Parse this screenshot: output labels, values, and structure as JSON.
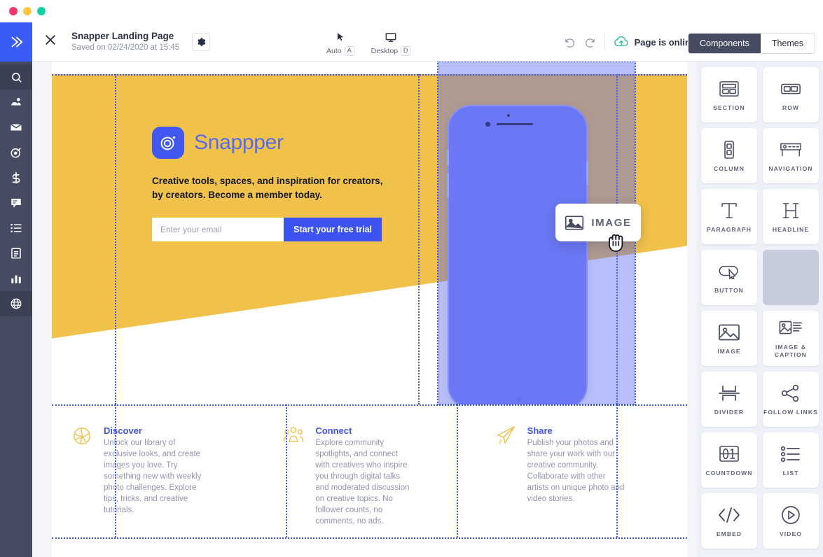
{
  "window": {
    "traffic_lights": [
      "close-red",
      "minimize-yellow",
      "maximize-green"
    ]
  },
  "rail": {
    "logo_icon": "chevrons-right-icon",
    "items": [
      {
        "name": "search",
        "icon": "search-icon",
        "active": true
      },
      {
        "name": "audience",
        "icon": "people-icon",
        "active": false
      },
      {
        "name": "campaigns",
        "icon": "envelope-icon",
        "active": false
      },
      {
        "name": "automations",
        "icon": "target-icon",
        "active": false
      },
      {
        "name": "ecommerce",
        "icon": "dollar-icon",
        "active": false
      },
      {
        "name": "conversations",
        "icon": "chat-icon",
        "active": false
      },
      {
        "name": "lists",
        "icon": "list-icon",
        "active": false
      },
      {
        "name": "content",
        "icon": "document-icon",
        "active": false
      },
      {
        "name": "reports",
        "icon": "bar-chart-icon",
        "active": false
      },
      {
        "name": "website",
        "icon": "globe-icon",
        "active": true
      }
    ]
  },
  "toolbar": {
    "close_icon": "close-icon",
    "title": "Snapper Landing Page",
    "saved": "Saved on 02/24/2020 at 15:45",
    "settings_icon": "gear-icon",
    "view_modes": [
      {
        "label": "Auto",
        "key": "A",
        "icon": "cursor-icon"
      },
      {
        "label": "Desktop",
        "key": "D",
        "icon": "monitor-icon"
      }
    ],
    "undo_icon": "undo-icon",
    "redo_icon": "redo-icon",
    "status_icon": "cloud-upload-icon",
    "status_text": "Page is online",
    "tabs": [
      {
        "label": "Components",
        "active": true
      },
      {
        "label": "Themes",
        "active": false
      }
    ]
  },
  "canvas": {
    "hero": {
      "brand_logo_icon": "camera-lens-icon",
      "brand_name": "Snappper",
      "subtitle": "Creative tools, spaces, and inspiration for creators, by creators. Become a member today.",
      "email_placeholder": "Enter your email",
      "email_value": "",
      "cta_label": "Start your free trial",
      "background_color": "#f0c24b",
      "phone_color": "#7b86f5"
    },
    "drop_target": {
      "active": true,
      "fill_color": "#5663f2",
      "border_color": "#3d53ef"
    },
    "features": [
      {
        "icon": "discover-globe-icon",
        "title": "Discover",
        "body": "Unlock our library of exclusive looks, and create images you love. Try something new with weekly photo challenges. Explore tips, tricks, and creative tutorials."
      },
      {
        "icon": "people-group-icon",
        "title": "Connect",
        "body": "Explore community spotlights, and connect with creatives who inspire you through digital talks and moderated discussion on creative topics. No follower counts, no comments, no ads."
      },
      {
        "icon": "paper-plane-icon",
        "title": "Share",
        "body": "Publish your photos and share your work with our creative community. Collaborate with other artists on unique photo and video stories."
      }
    ]
  },
  "components_panel": {
    "items": [
      {
        "label": "SECTION",
        "icon": "section-icon",
        "ghost": false
      },
      {
        "label": "ROW",
        "icon": "row-icon",
        "ghost": false
      },
      {
        "label": "COLUMN",
        "icon": "column-icon",
        "ghost": false
      },
      {
        "label": "NAVIGATION",
        "icon": "navigation-icon",
        "ghost": false
      },
      {
        "label": "PARAGRAPH",
        "icon": "paragraph-t-icon",
        "ghost": false
      },
      {
        "label": "HEADLINE",
        "icon": "headline-h-icon",
        "ghost": false
      },
      {
        "label": "BUTTON",
        "icon": "button-icon",
        "ghost": false
      },
      {
        "label": "",
        "icon": "placeholder",
        "ghost": true
      },
      {
        "label": "IMAGE",
        "icon": "image-icon",
        "ghost": false
      },
      {
        "label": "IMAGE & CAPTION",
        "icon": "image-caption-icon",
        "ghost": false
      },
      {
        "label": "DIVIDER",
        "icon": "divider-icon",
        "ghost": false
      },
      {
        "label": "FOLLOW LINKS",
        "icon": "share-nodes-icon",
        "ghost": false
      },
      {
        "label": "COUNTDOWN",
        "icon": "countdown-icon",
        "ghost": false
      },
      {
        "label": "LIST",
        "icon": "list-bullets-icon",
        "ghost": false
      },
      {
        "label": "EMBED",
        "icon": "code-embed-icon",
        "ghost": false
      },
      {
        "label": "VIDEO",
        "icon": "video-play-icon",
        "ghost": false
      }
    ]
  },
  "drag_ghost": {
    "icon": "image-icon",
    "label": "IMAGE",
    "cursor": "grabbing-hand-cursor"
  },
  "colors": {
    "rail_bg": "#464b61",
    "accent_blue": "#3d53ef",
    "brand_yellow": "#f0c24b",
    "panel_bg": "#eef1f7",
    "guide_blue": "#3d53ef"
  }
}
